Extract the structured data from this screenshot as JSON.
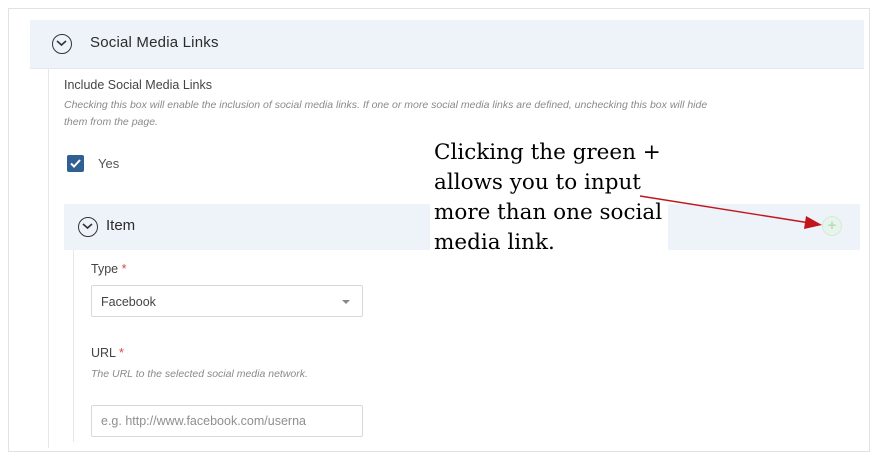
{
  "section": {
    "title": "Social Media Links",
    "collapse_icon": "chevron-down-circle-icon"
  },
  "include_field": {
    "label": "Include Social Media Links",
    "help_line1": "Checking this box will enable the inclusion of social media links. If one or more social media links are defined, unchecking this box will hide",
    "help_line2": "them from the page.",
    "checked": true,
    "checkbox_label": "Yes"
  },
  "item": {
    "title": "Item",
    "add_icon": "plus-circle-icon",
    "add_color": "#b9dcc0",
    "type_field": {
      "label": "Type",
      "required_mark": "*",
      "value": "Facebook"
    },
    "url_field": {
      "label": "URL",
      "required_mark": "*",
      "help": "The URL to the selected social media network.",
      "placeholder": "e.g. http://www.facebook.com/userna"
    }
  },
  "annotation": {
    "text": "Clicking the green + allows you to input more than one social media link.",
    "arrow_color": "#c0161b"
  },
  "colors": {
    "header_bg": "#eef3f9",
    "checkbox": "#2f5f93",
    "required": "#d94a4a"
  }
}
